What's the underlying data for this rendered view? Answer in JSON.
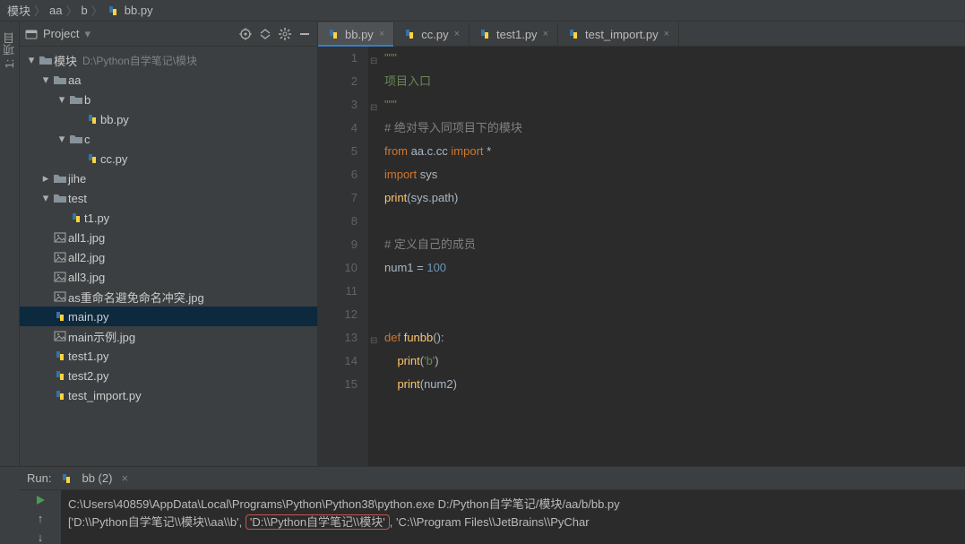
{
  "breadcrumb": {
    "root": "模块",
    "a": "aa",
    "b": "b",
    "file": "bb.py"
  },
  "sidebar": {
    "project_tab": "1: 项目"
  },
  "project": {
    "title": "Project",
    "tree": [
      {
        "depth": 0,
        "arrow": "▾",
        "type": "folder",
        "label": "模块",
        "suffix": "D:\\Python自学笔记\\模块"
      },
      {
        "depth": 1,
        "arrow": "▾",
        "type": "folder",
        "label": "aa"
      },
      {
        "depth": 2,
        "arrow": "▾",
        "type": "folder",
        "label": "b"
      },
      {
        "depth": 3,
        "arrow": "",
        "type": "py",
        "label": "bb.py"
      },
      {
        "depth": 2,
        "arrow": "▾",
        "type": "folder",
        "label": "c"
      },
      {
        "depth": 3,
        "arrow": "",
        "type": "py",
        "label": "cc.py"
      },
      {
        "depth": 1,
        "arrow": "▸",
        "type": "folder",
        "label": "jihe"
      },
      {
        "depth": 1,
        "arrow": "▾",
        "type": "folder",
        "label": "test"
      },
      {
        "depth": 2,
        "arrow": "",
        "type": "py",
        "label": "t1.py"
      },
      {
        "depth": 1,
        "arrow": "",
        "type": "img",
        "label": "all1.jpg"
      },
      {
        "depth": 1,
        "arrow": "",
        "type": "img",
        "label": "all2.jpg"
      },
      {
        "depth": 1,
        "arrow": "",
        "type": "img",
        "label": "all3.jpg"
      },
      {
        "depth": 1,
        "arrow": "",
        "type": "img",
        "label": "as重命名避免命名冲突.jpg"
      },
      {
        "depth": 1,
        "arrow": "",
        "type": "py",
        "label": "main.py",
        "sel": true
      },
      {
        "depth": 1,
        "arrow": "",
        "type": "img",
        "label": "main示例.jpg"
      },
      {
        "depth": 1,
        "arrow": "",
        "type": "py",
        "label": "test1.py"
      },
      {
        "depth": 1,
        "arrow": "",
        "type": "py",
        "label": "test2.py"
      },
      {
        "depth": 1,
        "arrow": "",
        "type": "py",
        "label": "test_import.py"
      }
    ]
  },
  "tabs": [
    {
      "label": "bb.py",
      "active": true
    },
    {
      "label": "cc.py"
    },
    {
      "label": "test1.py"
    },
    {
      "label": "test_import.py"
    }
  ],
  "code": {
    "lines": [
      {
        "n": 1,
        "html": "<span class='str'>\"\"\"</span>"
      },
      {
        "n": 2,
        "html": "<span class='str'>项目入口</span>"
      },
      {
        "n": 3,
        "html": "<span class='str'>\"\"\"</span>"
      },
      {
        "n": 4,
        "html": "<span class='cm'># 绝对导入同项目下的模块</span>"
      },
      {
        "n": 5,
        "html": "<span class='kw'>from</span> aa.c.cc <span class='kw'>import</span> *"
      },
      {
        "n": 6,
        "html": "<span class='kw'>import</span> sys"
      },
      {
        "n": 7,
        "html": "<span class='fn'>print</span>(sys.path)"
      },
      {
        "n": 8,
        "html": ""
      },
      {
        "n": 9,
        "html": "<span class='cm'># 定义自己的成员</span>"
      },
      {
        "n": 10,
        "html": "num1 = <span class='num'>100</span>"
      },
      {
        "n": 11,
        "html": ""
      },
      {
        "n": 12,
        "html": ""
      },
      {
        "n": 13,
        "html": "<span class='kw'>def</span> <span class='fn'>funbb</span>():"
      },
      {
        "n": 14,
        "html": "    <span class='fn'>print</span>(<span class='str'>'b'</span>)"
      },
      {
        "n": 15,
        "html": "    <span class='fn'>print</span>(num2)"
      }
    ]
  },
  "run": {
    "label": "Run:",
    "tab": "bb (2)",
    "line1": "C:\\Users\\40859\\AppData\\Local\\Programs\\Python\\Python38\\python.exe D:/Python自学笔记/模块/aa/b/bb.py",
    "line2_pre": "['D:\\\\Python自学笔记\\\\模块\\\\aa\\\\b',",
    "line2_hl": "'D:\\\\Python自学笔记\\\\模块'",
    "line2_post": ", 'C:\\\\Program Files\\\\JetBrains\\\\PyChar"
  }
}
